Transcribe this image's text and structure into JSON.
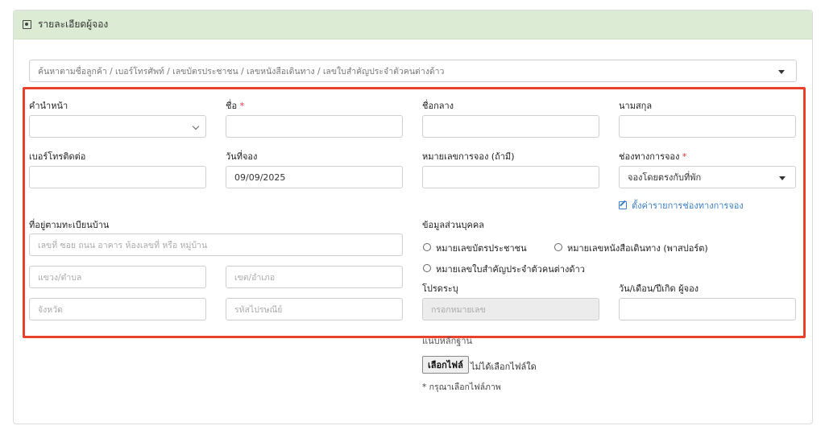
{
  "header": {
    "title": "รายละเอียดผู้จอง"
  },
  "search": {
    "placeholder": "ค้นหาตามชื่อลูกค้า / เบอร์โทรศัพท์ / เลขบัตรประชาชน / เลขหนังสือเดินทาง / เลขใบสำคัญประจำตัวคนต่างด้าว"
  },
  "form": {
    "title_label": "คำนำหน้า",
    "title_value": "",
    "first_name_label": "ชื่อ",
    "required_mark": "*",
    "middle_name_label": "ชื่อกลาง",
    "last_name_label": "นามสกุล",
    "phone_label": "เบอร์โทรติดต่อ",
    "booking_date_label": "วันที่จอง",
    "booking_date_value": "09/09/2025",
    "booking_number_label": "หมายเลขการจอง (ถ้ามี)",
    "channel_label": "ช่องทางการจอง",
    "channel_value": "จองโดยตรงกับที่พัก",
    "channel_settings_link": "ตั้งค่ารายการช่องทางการจอง",
    "address_label": "ที่อยู่ตามทะเบียนบ้าน",
    "address_placeholder": "เลขที่ ซอย ถนน อาคาร ห้องเลขที่ หรือ หมู่บ้าน",
    "subdistrict_placeholder": "แขวง/ตำบล",
    "district_placeholder": "เขต/อำเภอ",
    "province_placeholder": "จังหวัด",
    "postcode_placeholder": "รหัสไปรษณีย์",
    "personal_info_label": "ข้อมูลส่วนบุคคล",
    "id_options": [
      "หมายเลขบัตรประชาชน",
      "หมายเลขหนังสือเดินทาง (พาสปอร์ต)",
      "หมายเลขใบสำคัญประจำตัวคนต่างด้าว"
    ],
    "specify_label": "โปรดระบุ",
    "specify_placeholder": "กรอกหมายเลข",
    "dob_label": "วัน/เดือน/ปีเกิด ผู้จอง",
    "evidence_label": "แนบหลักฐาน",
    "file_button": "เลือกไฟล์",
    "file_status": "ไม่ได้เลือกไฟล์ใด",
    "file_note": "* กรุณาเลือกไฟล์ภาพ"
  },
  "colors": {
    "header_bg": "#dcebd3",
    "highlight": "#e8412c",
    "link": "#3a7fc4",
    "required": "#e0323a"
  }
}
